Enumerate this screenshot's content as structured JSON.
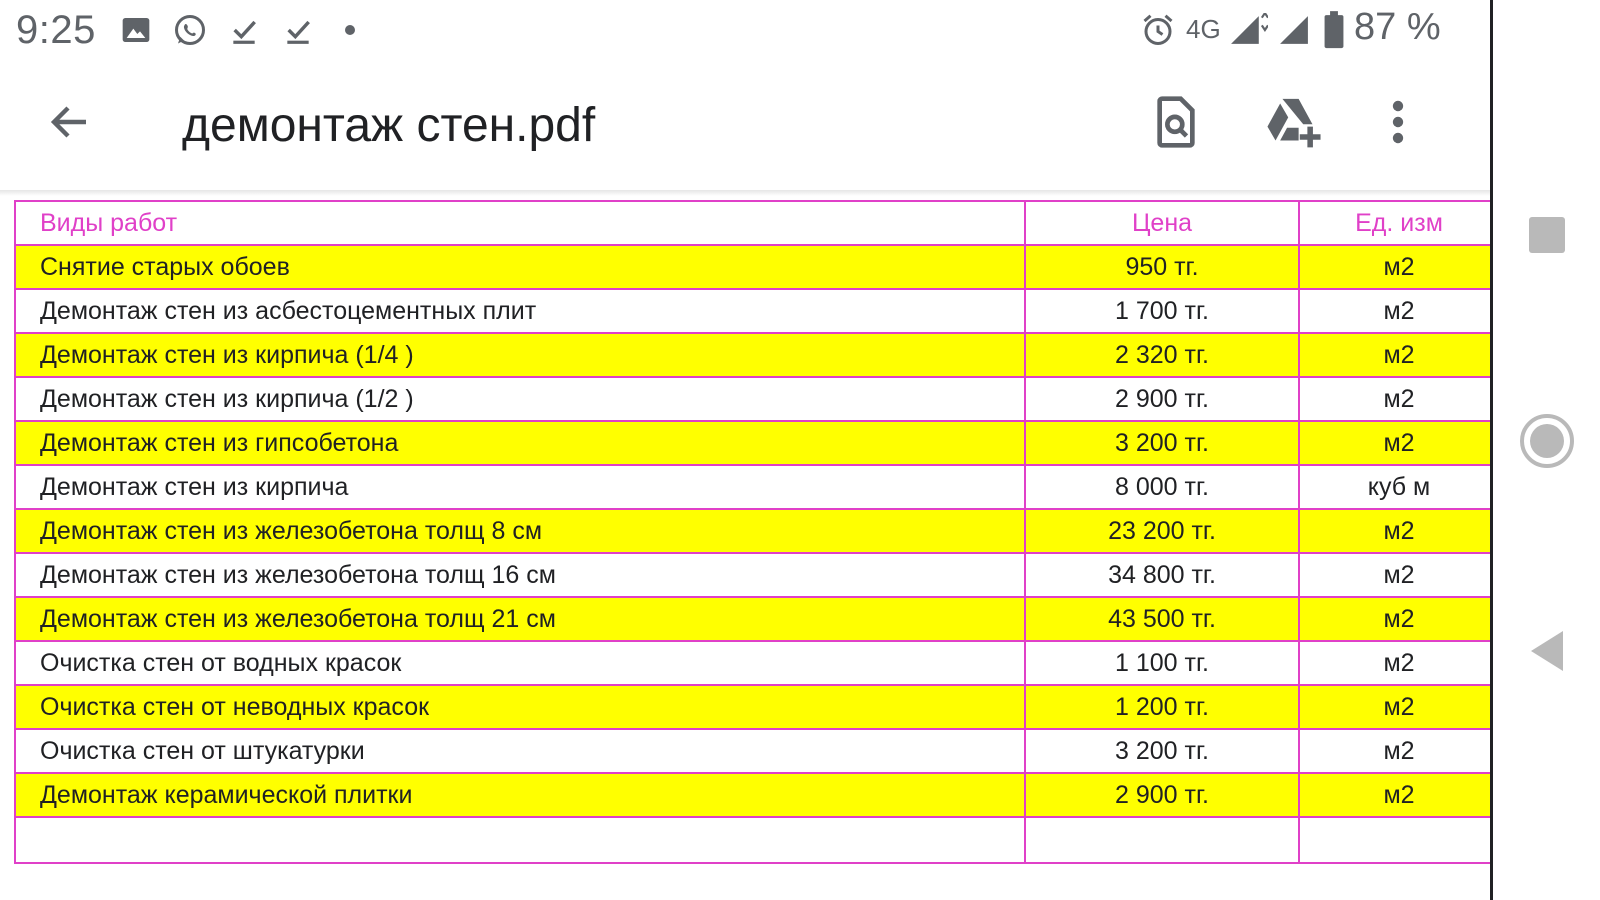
{
  "status_bar": {
    "time": "9:25",
    "network": "4G",
    "battery": "87 %",
    "icons": [
      "image-icon",
      "whatsapp-icon",
      "download-done-icon",
      "download-done-icon",
      "dot-icon",
      "alarm-icon",
      "signal-icon",
      "signal-icon",
      "battery-icon"
    ]
  },
  "app_bar": {
    "title": "демонтаж стен.pdf",
    "icons": [
      "back-arrow-icon",
      "search-document-icon",
      "drive-add-icon",
      "more-vert-icon"
    ]
  },
  "table": {
    "headers": [
      "Виды работ",
      "Цена",
      "Ед. изм"
    ],
    "rows": [
      {
        "name": "Снятие старых обоев",
        "price": "950 тг.",
        "unit": "м2",
        "highlight": true
      },
      {
        "name": "Демонтаж стен из асбестоцементных плит",
        "price": "1 700 тг.",
        "unit": "м2",
        "highlight": false
      },
      {
        "name": "Демонтаж стен из кирпича (1/4 )",
        "price": "2 320 тг.",
        "unit": "м2",
        "highlight": true
      },
      {
        "name": "Демонтаж стен из кирпича (1/2 )",
        "price": "2 900 тг.",
        "unit": "м2",
        "highlight": false
      },
      {
        "name": "Демонтаж стен из гипсобетона",
        "price": "3 200 тг.",
        "unit": "м2",
        "highlight": true
      },
      {
        "name": "Демонтаж стен из кирпича",
        "price": "8 000 тг.",
        "unit": "куб м",
        "highlight": false
      },
      {
        "name": "Демонтаж стен из железобетона толщ 8 см",
        "price": "23 200 тг.",
        "unit": "м2",
        "highlight": true
      },
      {
        "name": "Демонтаж стен из железобетона толщ 16 см",
        "price": "34 800 тг.",
        "unit": "м2",
        "highlight": false
      },
      {
        "name": "Демонтаж стен из железобетона толщ 21 см",
        "price": "43 500 тг.",
        "unit": "м2",
        "highlight": true
      },
      {
        "name": "Очистка стен от водных красок",
        "price": "1 100 тг.",
        "unit": "м2",
        "highlight": false
      },
      {
        "name": "Очистка стен от неводных красок",
        "price": "1 200 тг.",
        "unit": "м2",
        "highlight": true
      },
      {
        "name": "Очистка стен от штукатурки",
        "price": "3 200 тг.",
        "unit": "м2",
        "highlight": false
      },
      {
        "name": "Демонтаж керамической плитки",
        "price": "2 900 тг.",
        "unit": "м2",
        "highlight": true
      }
    ]
  },
  "nav_bar": {
    "icons": [
      "recents-square-icon",
      "home-circle-icon",
      "back-triangle-icon"
    ]
  },
  "colors": {
    "border": "#e040c8",
    "header_text": "#e040c8",
    "highlight": "#ffff00",
    "icon_gray": "#5f6368"
  }
}
